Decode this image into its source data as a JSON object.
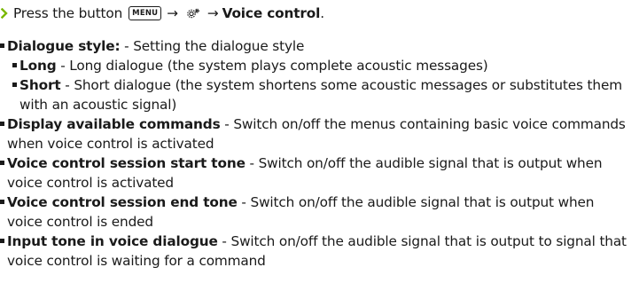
{
  "instruction": {
    "prefix": "Press the button",
    "key_label": "MENU",
    "arrow": "→",
    "gear_icon": "settings-gear-icon",
    "target": "Voice control",
    "suffix": "."
  },
  "items": [
    {
      "term": "Dialogue style:",
      "desc": " - Setting the dialogue style",
      "sub": [
        {
          "term": "Long",
          "desc": " - Long dialogue (the system plays complete acoustic messages)"
        },
        {
          "term": "Short",
          "desc": " - Short dialogue (the system shortens some acoustic messages or substitutes them with an acoustic signal)"
        }
      ]
    },
    {
      "term": "Display available commands",
      "desc": " - Switch on/off the menus containing basic voice commands when voice control is activated"
    },
    {
      "term": "Voice control session start tone",
      "desc": " - Switch on/off the audible signal that is output when voice control is activated"
    },
    {
      "term": "Voice control session end tone",
      "desc": " - Switch on/off the audible signal that is out­put when voice control is ended"
    },
    {
      "term": "Input tone in voice dialogue",
      "desc": " - Switch on/off the audible signal that is output to signal that voice control is waiting for a command"
    }
  ],
  "colors": {
    "text": "#1a1a1a",
    "accent_arrow": "#7ab800"
  }
}
